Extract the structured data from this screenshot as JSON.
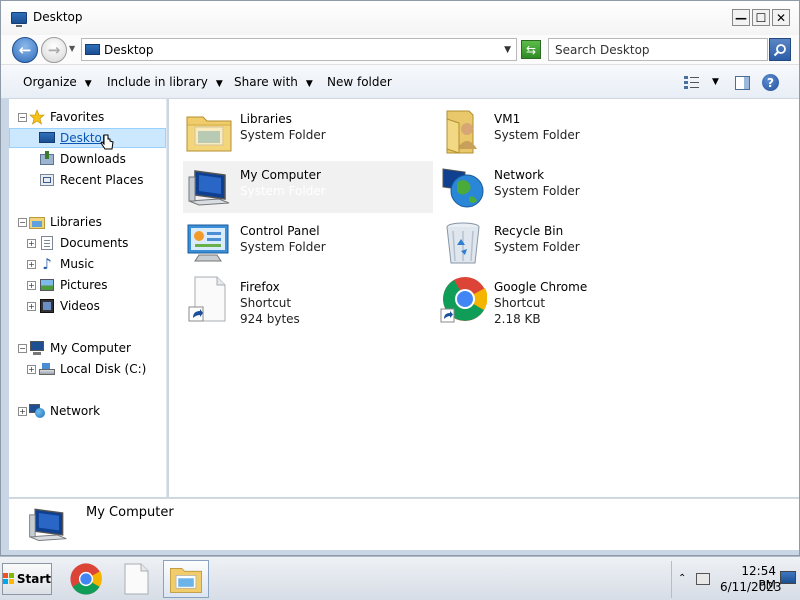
{
  "window": {
    "title": "Desktop",
    "controls": {
      "minimize": "—",
      "maximize": "☐",
      "close": "✕"
    }
  },
  "navbar": {
    "address": "Desktop",
    "search_placeholder": "Search Desktop"
  },
  "toolbar": {
    "organize": "Organize",
    "include_in_library": "Include in library",
    "share_with": "Share with",
    "new_folder": "New folder"
  },
  "sidebar": {
    "favorites": {
      "label": "Favorites",
      "items": [
        {
          "label": "Desktop",
          "icon": "desktop-icon",
          "selected": true
        },
        {
          "label": "Downloads",
          "icon": "downloads-icon"
        },
        {
          "label": "Recent Places",
          "icon": "recent-places-icon"
        }
      ]
    },
    "libraries": {
      "label": "Libraries",
      "items": [
        {
          "label": "Documents",
          "icon": "documents-icon"
        },
        {
          "label": "Music",
          "icon": "music-icon"
        },
        {
          "label": "Pictures",
          "icon": "pictures-icon"
        },
        {
          "label": "Videos",
          "icon": "videos-icon"
        }
      ]
    },
    "computer": {
      "label": "My Computer",
      "items": [
        {
          "label": "Local Disk (C:)",
          "icon": "local-disk-icon"
        }
      ]
    },
    "network": {
      "label": "Network"
    }
  },
  "items": [
    {
      "name": "Libraries",
      "line2": "System Folder",
      "line3": "",
      "icon": "libraries-folder-icon"
    },
    {
      "name": "VM1",
      "line2": "System Folder",
      "line3": "",
      "icon": "user-folder-icon"
    },
    {
      "name": "My Computer",
      "line2": "System Folder",
      "line3": "",
      "icon": "computer-icon",
      "hovered": true
    },
    {
      "name": "Network",
      "line2": "System Folder",
      "line3": "",
      "icon": "network-globe-icon"
    },
    {
      "name": "Control Panel",
      "line2": "System Folder",
      "line3": "",
      "icon": "control-panel-icon"
    },
    {
      "name": "Recycle Bin",
      "line2": "System Folder",
      "line3": "",
      "icon": "recycle-bin-icon"
    },
    {
      "name": "Firefox",
      "line2": "Shortcut",
      "line3": "924 bytes",
      "icon": "shortcut-file-icon"
    },
    {
      "name": "Google Chrome",
      "line2": "Shortcut",
      "line3": "2.18 KB",
      "icon": "chrome-icon"
    }
  ],
  "details": {
    "name": "My Computer"
  },
  "taskbar": {
    "start": "Start",
    "time": "12:54 PM",
    "date": "6/11/2023"
  }
}
